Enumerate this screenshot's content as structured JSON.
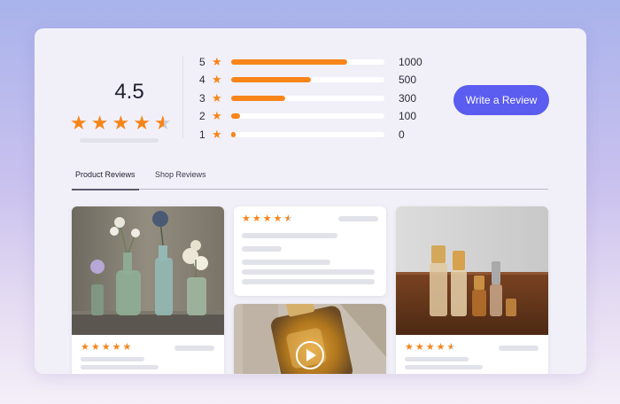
{
  "summary": {
    "average": "4.5"
  },
  "distribution": [
    {
      "stars": "5",
      "count": "1000",
      "fraction": 0.76
    },
    {
      "stars": "4",
      "count": "500",
      "fraction": 0.52
    },
    {
      "stars": "3",
      "count": "300",
      "fraction": 0.35
    },
    {
      "stars": "2",
      "count": "100",
      "fraction": 0.06
    },
    {
      "stars": "1",
      "count": "0",
      "fraction": 0.03
    }
  ],
  "cta": {
    "label": "Write a Review"
  },
  "tabs": [
    {
      "label": "Product Reviews",
      "active": true
    },
    {
      "label": "Shop Reviews",
      "active": false
    }
  ],
  "reviews": [
    {
      "rating": 5,
      "media": "photo-vases"
    },
    {
      "rating": 4.5,
      "media": "none"
    },
    {
      "rating": 0,
      "media": "video-perfume"
    },
    {
      "rating": 4.5,
      "media": "photo-perfume-bottles"
    }
  ],
  "colors": {
    "accent": "#5b5cf0",
    "star": "#f7851a",
    "skeleton": "#e2e2ea"
  }
}
